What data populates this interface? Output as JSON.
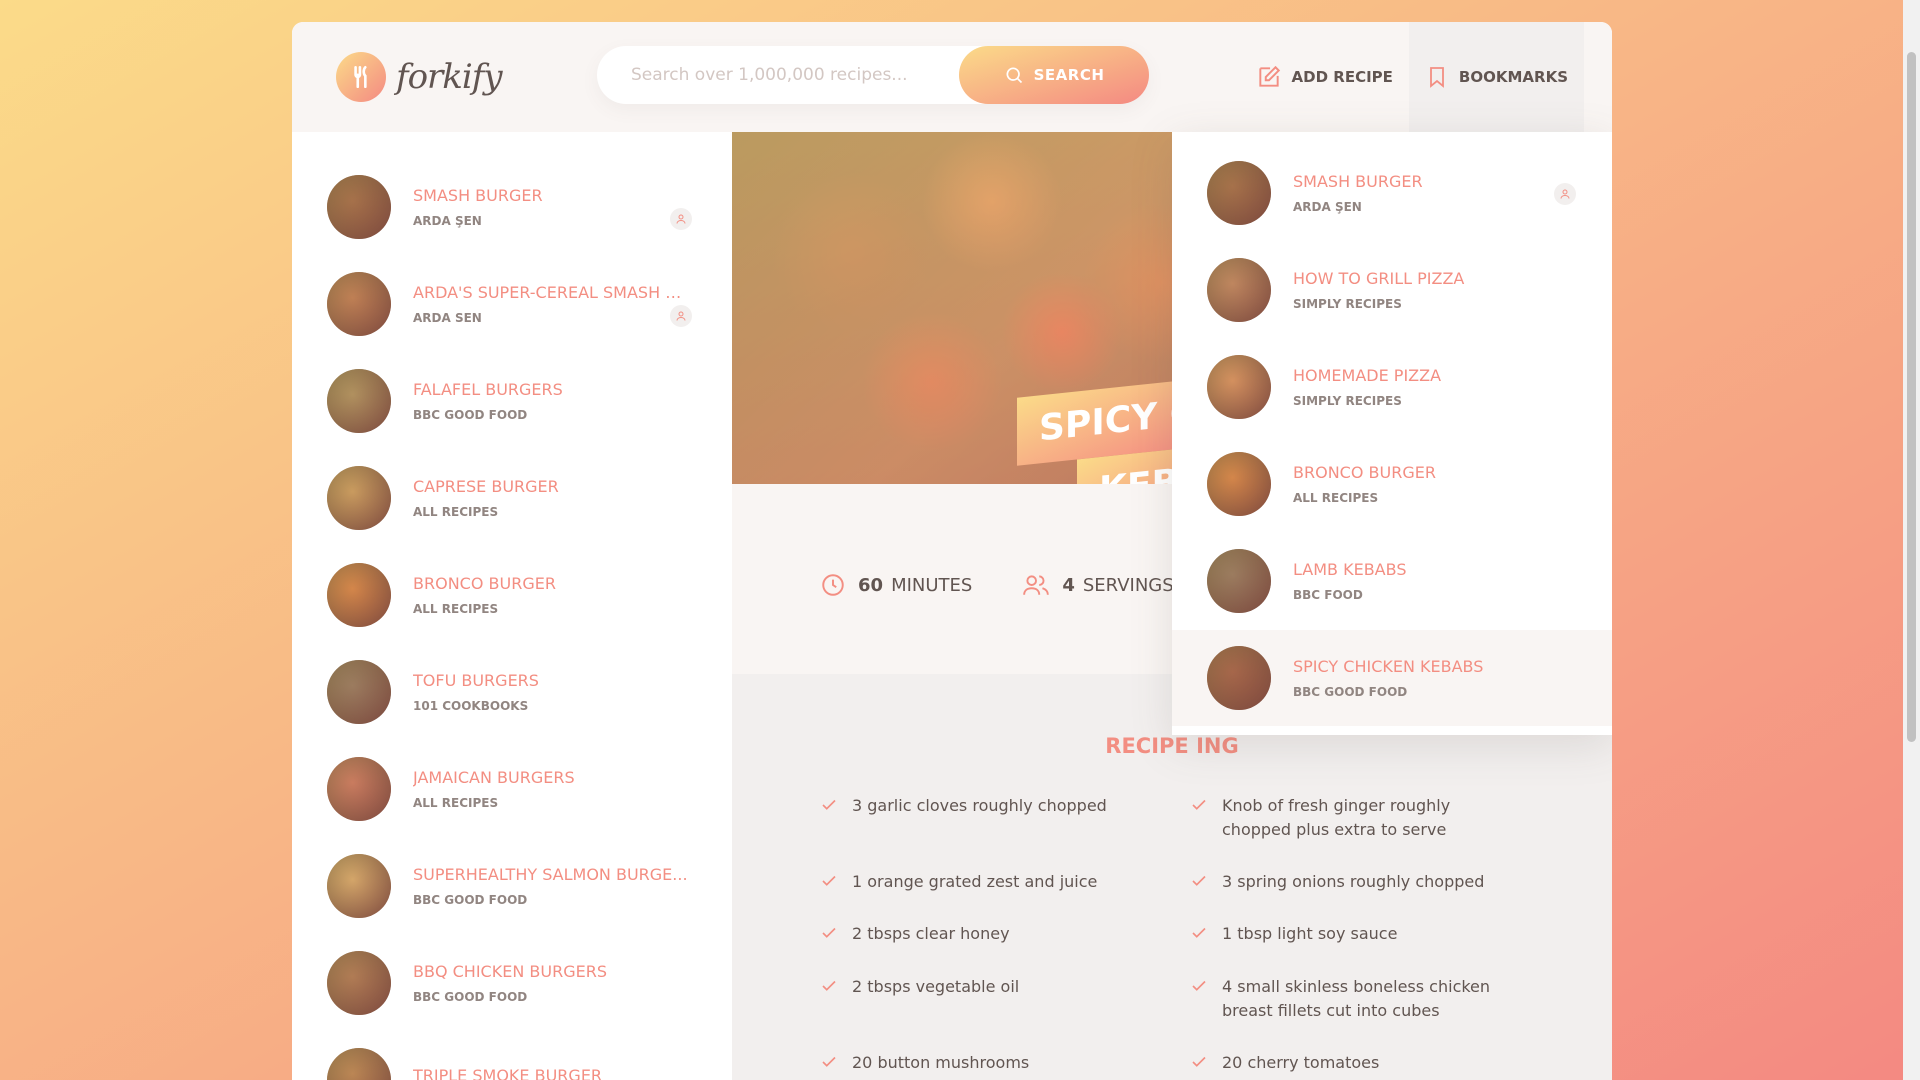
{
  "header": {
    "logo_text": "forkify",
    "search": {
      "placeholder": "Search over 1,000,000 recipes...",
      "button_label": "SEARCH"
    },
    "nav": {
      "add_recipe": "ADD RECIPE",
      "bookmarks": "BOOKMARKS"
    }
  },
  "results": [
    {
      "title": "SMASH BURGER",
      "publisher": "ARDA ŞEN",
      "user": true,
      "thumb": "#7a4a2a"
    },
    {
      "title": "ARDA'S SUPER-CEREAL SMASH B...",
      "publisher": "ARDA SEN",
      "user": true,
      "thumb": "#a0603a"
    },
    {
      "title": "FALAFEL BURGERS",
      "publisher": "BBC GOOD FOOD",
      "user": false,
      "thumb": "#8a7a4a"
    },
    {
      "title": "CAPRESE BURGER",
      "publisher": "ALL RECIPES",
      "user": false,
      "thumb": "#b08a4a"
    },
    {
      "title": "BRONCO BURGER",
      "publisher": "ALL RECIPES",
      "user": false,
      "thumb": "#c06a2a"
    },
    {
      "title": "TOFU BURGERS",
      "publisher": "101 COOKBOOKS",
      "user": false,
      "thumb": "#6a5a4a"
    },
    {
      "title": "JAMAICAN BURGERS",
      "publisher": "ALL RECIPES",
      "user": false,
      "thumb": "#b05a4a"
    },
    {
      "title": "SUPERHEALTHY SALMON BURGE...",
      "publisher": "BBC GOOD FOOD",
      "user": false,
      "thumb": "#c09a5a"
    },
    {
      "title": "BBQ CHICKEN BURGERS",
      "publisher": "BBC GOOD FOOD",
      "user": false,
      "thumb": "#8a5a3a"
    },
    {
      "title": "TRIPLE SMOKE BURGER",
      "publisher": "",
      "user": false,
      "thumb": "#9a6a3a"
    }
  ],
  "recipe": {
    "title_line1": "SPICY C",
    "title_line2": "KEBA",
    "cooking_time": "60",
    "cooking_unit": "MINUTES",
    "servings": "4",
    "servings_unit": "SERVINGS",
    "ingredients_heading": "RECIPE ING",
    "ingredients": [
      "3 garlic cloves roughly chopped",
      "Knob of fresh ginger roughly chopped plus extra to serve",
      "1 orange grated zest and juice",
      "3 spring onions roughly chopped",
      "2 tbsps clear honey",
      "1 tbsp light soy sauce",
      "2 tbsps vegetable oil",
      "4 small skinless boneless chicken breast fillets cut into cubes",
      "20 button mushrooms",
      "20 cherry tomatoes"
    ]
  },
  "bookmarks": [
    {
      "title": "SMASH BURGER",
      "publisher": "ARDA ŞEN",
      "user": true,
      "active": false,
      "thumb": "#7a4a2a"
    },
    {
      "title": "HOW TO GRILL PIZZA",
      "publisher": "SIMPLY RECIPES",
      "user": false,
      "active": false,
      "thumb": "#a06a4a"
    },
    {
      "title": "HOMEMADE PIZZA",
      "publisher": "SIMPLY RECIPES",
      "user": false,
      "active": false,
      "thumb": "#c07a4a"
    },
    {
      "title": "BRONCO BURGER",
      "publisher": "ALL RECIPES",
      "user": false,
      "active": false,
      "thumb": "#c06a2a"
    },
    {
      "title": "LAMB KEBABS",
      "publisher": "BBC FOOD",
      "user": false,
      "active": false,
      "thumb": "#6a5a4a"
    },
    {
      "title": "SPICY CHICKEN KEBABS",
      "publisher": "BBC GOOD FOOD",
      "user": false,
      "active": true,
      "thumb": "#7a3a2a"
    }
  ],
  "colors": {
    "accent": "#f38e82",
    "gradient_start": "#fbdb89",
    "gradient_end": "#f48982",
    "text": "#615551"
  }
}
